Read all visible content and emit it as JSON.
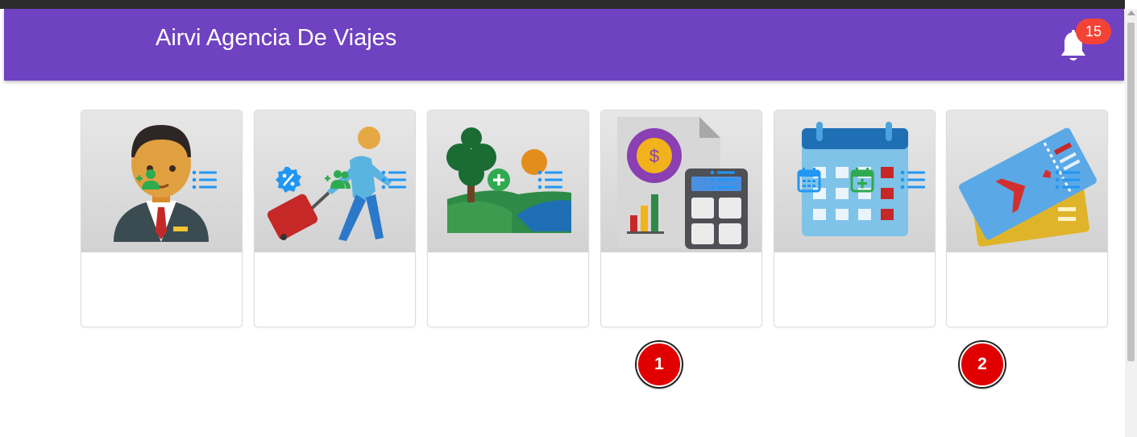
{
  "app": {
    "title": "Airvi Agencia De Viajes"
  },
  "notifications": {
    "count": "15",
    "icon": "bell-icon"
  },
  "colors": {
    "appbar": "#6f42c1",
    "badge": "#f44336",
    "green": "#2eaa4f",
    "blue": "#2196f3",
    "marker": "#e00000"
  },
  "cards": [
    {
      "name": "employee",
      "image_icon": "receptionist-icon",
      "actions": [
        "add-user-icon",
        "list-icon"
      ]
    },
    {
      "name": "traveler",
      "image_icon": "traveler-luggage-icon",
      "actions": [
        "discount-badge-icon",
        "add-group-icon",
        "list-icon"
      ]
    },
    {
      "name": "destination",
      "image_icon": "landscape-icon",
      "actions": [
        "add-circle-icon",
        "list-icon"
      ]
    },
    {
      "name": "finance",
      "image_icon": "accounting-calculator-icon",
      "actions": [
        "list-icon"
      ]
    },
    {
      "name": "calendar",
      "image_icon": "calendar-icon",
      "actions": [
        "calendar-view-icon",
        "calendar-add-icon",
        "list-icon"
      ]
    },
    {
      "name": "tickets",
      "image_icon": "flight-ticket-icon",
      "actions": [
        "list-icon"
      ]
    }
  ],
  "markers": [
    "1",
    "2"
  ]
}
